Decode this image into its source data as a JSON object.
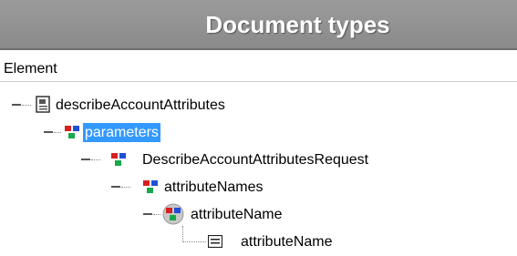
{
  "header": {
    "title": "Document types"
  },
  "columns": {
    "element": "Element"
  },
  "tree": {
    "items": [
      {
        "label": "describeAccountAttributes",
        "icon": "document-icon"
      },
      {
        "label": "parameters",
        "icon": "structure-icon",
        "selected": true
      },
      {
        "label": "DescribeAccountAttributesRequest",
        "icon": "structure-icon"
      },
      {
        "label": "attributeNames",
        "icon": "structure-icon"
      },
      {
        "label": "attributeName",
        "icon": "structure-list-icon"
      },
      {
        "label": "attributeName",
        "icon": "field-icon"
      }
    ]
  },
  "colors": {
    "title_bar": "#8f8f8f",
    "selection": "#3399ff"
  }
}
